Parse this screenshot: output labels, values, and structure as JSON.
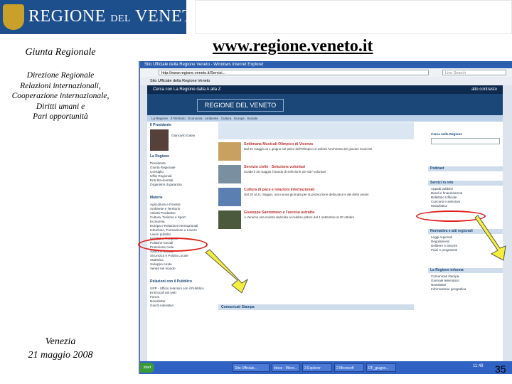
{
  "slide": {
    "banner_title_main": "REGIONE",
    "banner_title_del": "DEL",
    "banner_title_end": "VENETO",
    "url_title": "www.regione.veneto.it",
    "giunta": "Giunta Regionale",
    "direzione_lines": [
      "Direzione Regionale",
      "Relazioni internazionali,",
      "Cooperazione internazionale,",
      "Diritti umani e",
      "Pari opportunità"
    ],
    "footer_city": "Venezia",
    "footer_date": "21 maggio 2008",
    "page_number": "35"
  },
  "browser": {
    "window_title": "Sito Ufficiale della Regione Veneto - Windows Internet Explorer",
    "address": "http://www.regione.veneto.it/Servizi...",
    "search_placeholder": "Live Search",
    "tab_label": "Sito Ufficiale della Regione Veneto",
    "site_topbar": "Cerca con La Regione dalla A alla Z",
    "high_contrast": "alto contrasto",
    "site_logo": "REGIONE DEL VENETO",
    "nav_items": [
      "La Regione",
      "Il Territorio",
      "Economia",
      "Ambiente",
      "Cultura",
      "Europa",
      "Sociale"
    ],
    "left_sidebar": {
      "president_label": "Il Presidente",
      "president_name": "Giancarlo Galan",
      "section_regione": "La Regione",
      "regione_items": [
        "Presidente",
        "Giunta Regionale",
        "Consiglio",
        "Uffici Regionali",
        "Enti Strumentali",
        "Organismi di garanzia"
      ],
      "section_materie": "Materie",
      "materie_items": [
        "Agricoltura e Foreste",
        "Ambiente e Territorio",
        "Attività Produttive",
        "Cultura, Turismo e Sport",
        "Economia",
        "Europa e Relazioni Internazionali",
        "Istruzione, Formazione e Lavoro",
        "Lavori pubblici",
        "Mobilità e Trasporti",
        "Politiche Sociali",
        "Protezione civile",
        "Sanità e Sociale",
        "Sicurezza e Polizia Locale",
        "Statistica",
        "Sviluppo rurale",
        "Veneti nel mondo"
      ],
      "section_relazioni": "Relazioni con il Pubblico",
      "relazioni_items": [
        "URP - Ufficio relazioni con il Pubblico",
        "Enti locali nel web",
        "Forum",
        "Newsletter",
        "Giochi interattivi"
      ]
    },
    "news": [
      {
        "title": "Settimana Musicali Olimpico di Vicenza",
        "text": "Dal 31 maggio al 1 giugno sul palco dell'Olimpico si esibirà l'orchestra dei giovani musicisti"
      },
      {
        "title": "Servizio civile - Selezione volontari",
        "text": "Scade il 30 maggio il bando di selezione per 637 volontari"
      },
      {
        "title": "Cultura di pace e relazioni internazionali",
        "text": "Dal 20 al 21 maggio, una nuova giornata per la promozione della pace e dei diritti umani"
      },
      {
        "title": "Giuseppe Santomaso e l'ascesa astratta",
        "text": "A Venezia una mostra dedicata al celebre pittore dal 1 settembre al 30 ottobre"
      }
    ],
    "comunicati_title": "Comunicati Stampa",
    "right_sidebar": {
      "search_label": "Cerca nella Regione",
      "box_podcast": "Podcast",
      "box_servizi": "Servizi in rete",
      "servizi_items": [
        "Appalti pubblici",
        "Bandi e finanziamenti",
        "Bollettino Ufficiale",
        "Concorsi e selezioni",
        "Modulistica"
      ],
      "box_normativa": "Normativa e atti regionali",
      "normativa_items": [
        "Leggi regionali",
        "Regolamenti",
        "Delibere e Decreti",
        "Piani e programmi"
      ],
      "box_informa": "La Regione informa",
      "informa_items": [
        "Comunicati stampa",
        "Giornale telematico",
        "Newsletter",
        "Informazione geografica"
      ]
    },
    "taskbar_start": "start",
    "taskbar_items": [
      "Sito Ufficiale...",
      "Inbox - Micro...",
      "2 Explorer",
      "2 Microsoft",
      "DF_giugno..."
    ],
    "clock": "11:49"
  },
  "colors": {
    "banner_blue": "#1d4f8c",
    "highlight_red": "#e0201c",
    "arrow_yellow": "#f4ef3a"
  }
}
